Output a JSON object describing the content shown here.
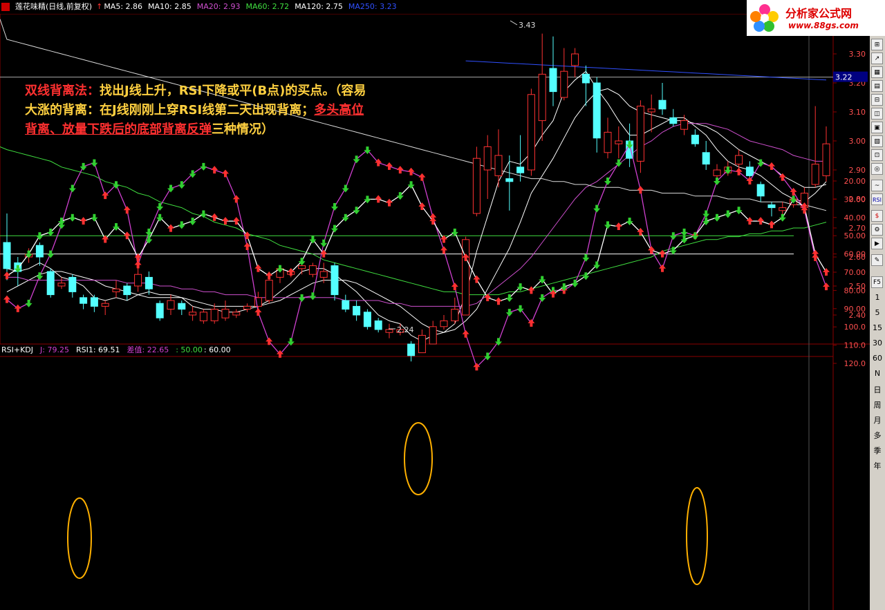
{
  "header": {
    "title": "莲花味精(日线,前复权)",
    "ma": [
      {
        "label": "MA5: 2.86",
        "color": "#ffffff"
      },
      {
        "label": "MA10: 2.85",
        "color": "#ffffff"
      },
      {
        "label": "MA20: 2.93",
        "color": "#d050d0"
      },
      {
        "label": "MA60: 2.72",
        "color": "#40e040"
      },
      {
        "label": "MA120: 2.75",
        "color": "#ffffff"
      },
      {
        "label": "MA250: 3.23",
        "color": "#3050ff"
      }
    ]
  },
  "logo": {
    "title": "分析家公式网",
    "url": "www.88gs.com"
  },
  "annotation": {
    "part1": "双线背离法：",
    "part2": "找出J线上升，RSI下降或平(B点)的买点。（容易大涨的背离：在J线刚刚上穿RSI线第二天出现背离；",
    "part3": "多头高位背离、放量下跌后的底部背离反弹",
    "part4": "三种情况）"
  },
  "subheader": {
    "name": "RSI+KDJ",
    "j": "J: 79.25",
    "rsi": "RSI1: 69.51",
    "diff": "差值: 22.65",
    "l50": ": 50.00",
    "l60": ": 60.00"
  },
  "toolbar": {
    "items": [
      "1",
      "5",
      "15",
      "30",
      "60",
      "N",
      "日",
      "周",
      "月",
      "多",
      "季",
      "年"
    ],
    "rsi_label": "RSI"
  },
  "colors": {
    "up": "#ff3232",
    "down": "#54ffff",
    "grid": "#8b0000",
    "rsi": "#ffffff",
    "j": "#d040d0",
    "line60": "#ffffff",
    "line50": "#40e040",
    "circle": "#ffb000"
  },
  "chart_data": [
    {
      "type": "candlestick",
      "title": "",
      "ylim": [
        2.32,
        3.38
      ],
      "yticks": [
        "3.30",
        "3.20",
        "3.10",
        "3.00",
        "2.90",
        "2.80",
        "2.70",
        "2.60",
        "2.50",
        "2.40"
      ],
      "current_price": "3.22",
      "high_label": "3.43",
      "low_label": "2.24",
      "candles": [
        [
          2.65,
          2.56,
          2.75,
          2.52
        ],
        [
          2.58,
          2.55,
          2.6,
          2.5
        ],
        [
          2.6,
          2.61,
          2.63,
          2.58
        ],
        [
          2.64,
          2.6,
          2.65,
          2.57
        ],
        [
          2.55,
          2.47,
          2.56,
          2.46
        ],
        [
          2.5,
          2.51,
          2.53,
          2.49
        ],
        [
          2.53,
          2.48,
          2.54,
          2.46
        ],
        [
          2.46,
          2.44,
          2.47,
          2.42
        ],
        [
          2.46,
          2.43,
          2.47,
          2.41
        ],
        [
          2.43,
          2.44,
          2.45,
          2.4
        ],
        [
          2.48,
          2.49,
          2.52,
          2.46
        ],
        [
          2.5,
          2.47,
          2.51,
          2.45
        ],
        [
          2.5,
          2.54,
          2.57,
          2.48
        ],
        [
          2.53,
          2.49,
          2.55,
          2.47
        ],
        [
          2.44,
          2.39,
          2.45,
          2.38
        ],
        [
          2.42,
          2.45,
          2.47,
          2.4
        ],
        [
          2.44,
          2.42,
          2.45,
          2.4
        ],
        [
          2.4,
          2.41,
          2.43,
          2.38
        ],
        [
          2.38,
          2.41,
          2.42,
          2.37
        ],
        [
          2.38,
          2.42,
          2.44,
          2.37
        ],
        [
          2.39,
          2.42,
          2.45,
          2.38
        ],
        [
          2.4,
          2.41,
          2.42,
          2.39
        ],
        [
          2.42,
          2.43,
          2.44,
          2.41
        ],
        [
          2.43,
          2.46,
          2.48,
          2.42
        ],
        [
          2.45,
          2.52,
          2.55,
          2.44
        ],
        [
          2.53,
          2.56,
          2.57,
          2.51
        ],
        [
          2.54,
          2.55,
          2.56,
          2.53
        ],
        [
          2.56,
          2.57,
          2.58,
          2.54
        ],
        [
          2.54,
          2.57,
          2.58,
          2.53
        ],
        [
          2.53,
          2.55,
          2.58,
          2.51
        ],
        [
          2.57,
          2.47,
          2.58,
          2.45
        ],
        [
          2.45,
          2.42,
          2.47,
          2.41
        ],
        [
          2.43,
          2.4,
          2.45,
          2.38
        ],
        [
          2.41,
          2.36,
          2.42,
          2.35
        ],
        [
          2.38,
          2.35,
          2.39,
          2.34
        ],
        [
          2.34,
          2.35,
          2.37,
          2.32
        ],
        [
          2.34,
          2.35,
          2.37,
          2.33
        ],
        [
          2.3,
          2.26,
          2.31,
          2.24
        ],
        [
          2.27,
          2.33,
          2.35,
          2.27
        ],
        [
          2.3,
          2.36,
          2.38,
          2.3
        ],
        [
          2.36,
          2.38,
          2.4,
          2.35
        ],
        [
          2.38,
          2.42,
          2.46,
          2.37
        ],
        [
          2.4,
          2.66,
          2.67,
          2.4
        ],
        [
          2.75,
          2.94,
          2.98,
          2.74
        ],
        [
          2.9,
          2.98,
          3.02,
          2.8
        ],
        [
          2.88,
          2.95,
          3.04,
          2.84
        ],
        [
          2.87,
          2.86,
          2.95,
          2.76
        ],
        [
          2.91,
          2.89,
          3.02,
          2.86
        ],
        [
          2.9,
          3.16,
          3.18,
          2.88
        ],
        [
          3.07,
          3.23,
          3.37,
          3.0
        ],
        [
          3.25,
          3.17,
          3.36,
          3.12
        ],
        [
          3.15,
          3.24,
          3.32,
          3.14
        ],
        [
          3.26,
          3.3,
          3.32,
          3.22
        ],
        [
          3.23,
          3.2,
          3.26,
          3.12
        ],
        [
          3.2,
          3.01,
          3.22,
          2.96
        ],
        [
          2.96,
          3.03,
          3.08,
          2.94
        ],
        [
          2.99,
          3.0,
          3.05,
          2.94
        ],
        [
          3.0,
          2.94,
          3.06,
          2.91
        ],
        [
          2.93,
          3.12,
          3.14,
          2.89
        ],
        [
          3.1,
          3.11,
          3.16,
          3.03
        ],
        [
          3.14,
          3.11,
          3.2,
          3.09
        ],
        [
          3.08,
          3.06,
          3.11,
          3.05
        ],
        [
          3.04,
          3.07,
          3.09,
          3.02
        ],
        [
          3.02,
          2.99,
          3.04,
          2.98
        ],
        [
          2.96,
          2.92,
          3.0,
          2.9
        ],
        [
          2.88,
          2.9,
          2.92,
          2.86
        ],
        [
          2.89,
          2.91,
          2.93,
          2.88
        ],
        [
          2.92,
          2.95,
          2.97,
          2.89
        ],
        [
          2.91,
          2.88,
          2.93,
          2.86
        ],
        [
          2.85,
          2.81,
          2.86,
          2.79
        ],
        [
          2.78,
          2.77,
          2.79,
          2.74
        ],
        [
          2.76,
          2.77,
          2.79,
          2.74
        ],
        [
          2.78,
          2.8,
          2.82,
          2.77
        ],
        [
          2.77,
          2.82,
          2.84,
          2.75
        ],
        [
          2.85,
          2.92,
          3.12,
          2.84
        ],
        [
          2.88,
          2.99,
          3.05,
          2.86
        ]
      ],
      "series": [
        {
          "name": "MA5",
          "values": [
            2.56,
            2.55,
            2.56,
            2.58,
            2.56,
            2.53,
            2.52,
            2.5,
            2.46,
            2.45,
            2.46,
            2.45,
            2.47,
            2.48,
            2.47,
            2.47,
            2.46,
            2.43,
            2.42,
            2.42,
            2.41,
            2.41,
            2.42,
            2.43,
            2.45,
            2.48,
            2.51,
            2.55,
            2.56,
            2.56,
            2.54,
            2.51,
            2.48,
            2.44,
            2.4,
            2.38,
            2.37,
            2.33,
            2.31,
            2.33,
            2.34,
            2.37,
            2.47,
            2.62,
            2.74,
            2.86,
            2.93,
            2.92,
            2.96,
            3.02,
            3.07,
            3.17,
            3.21,
            3.24,
            3.18,
            3.13,
            3.07,
            3.02,
            3.02,
            3.04,
            3.06,
            3.08,
            3.08,
            3.05,
            3.02,
            2.97,
            2.93,
            2.91,
            2.9,
            2.88,
            2.85,
            2.82,
            2.8,
            2.79,
            2.82,
            2.86
          ]
        },
        {
          "name": "MA10",
          "values": [
            2.48,
            2.5,
            2.52,
            2.54,
            2.55,
            2.55,
            2.54,
            2.53,
            2.52,
            2.5,
            2.49,
            2.48,
            2.47,
            2.46,
            2.46,
            2.46,
            2.46,
            2.45,
            2.44,
            2.43,
            2.43,
            2.43,
            2.43,
            2.43,
            2.44,
            2.45,
            2.47,
            2.49,
            2.51,
            2.52,
            2.52,
            2.52,
            2.51,
            2.49,
            2.47,
            2.45,
            2.43,
            2.4,
            2.37,
            2.35,
            2.34,
            2.35,
            2.38,
            2.42,
            2.49,
            2.56,
            2.63,
            2.72,
            2.82,
            2.88,
            2.94,
            3.01,
            3.08,
            3.13,
            3.17,
            3.18,
            3.16,
            3.12,
            3.1,
            3.09,
            3.08,
            3.07,
            3.07,
            3.06,
            3.05,
            3.03,
            3.0,
            2.97,
            2.95,
            2.93,
            2.91,
            2.88,
            2.86,
            2.84,
            2.84,
            2.85
          ]
        },
        {
          "name": "MA20",
          "values": [
            2.53,
            2.53,
            2.52,
            2.52,
            2.52,
            2.52,
            2.52,
            2.52,
            2.52,
            2.52,
            2.52,
            2.51,
            2.51,
            2.51,
            2.5,
            2.5,
            2.49,
            2.49,
            2.48,
            2.48,
            2.47,
            2.47,
            2.47,
            2.46,
            2.46,
            2.46,
            2.46,
            2.46,
            2.46,
            2.46,
            2.46,
            2.45,
            2.45,
            2.45,
            2.45,
            2.44,
            2.44,
            2.43,
            2.43,
            2.43,
            2.43,
            2.43,
            2.43,
            2.44,
            2.47,
            2.5,
            2.53,
            2.56,
            2.6,
            2.65,
            2.7,
            2.75,
            2.8,
            2.84,
            2.86,
            2.89,
            2.92,
            2.95,
            2.98,
            3.0,
            3.03,
            3.05,
            3.06,
            3.06,
            3.06,
            3.05,
            3.04,
            3.02,
            3.0,
            2.99,
            2.98,
            2.97,
            2.95,
            2.94,
            2.93,
            2.93
          ]
        },
        {
          "name": "MA60",
          "values": [
            2.97,
            2.96,
            2.95,
            2.94,
            2.93,
            2.91,
            2.9,
            2.89,
            2.88,
            2.86,
            2.85,
            2.84,
            2.82,
            2.81,
            2.79,
            2.78,
            2.77,
            2.75,
            2.74,
            2.72,
            2.71,
            2.7,
            2.68,
            2.67,
            2.66,
            2.64,
            2.63,
            2.62,
            2.61,
            2.59,
            2.58,
            2.57,
            2.56,
            2.55,
            2.54,
            2.53,
            2.52,
            2.51,
            2.5,
            2.49,
            2.48,
            2.48,
            2.47,
            2.47,
            2.47,
            2.47,
            2.48,
            2.48,
            2.49,
            2.5,
            2.51,
            2.52,
            2.53,
            2.54,
            2.55,
            2.56,
            2.57,
            2.58,
            2.59,
            2.6,
            2.62,
            2.63,
            2.64,
            2.65,
            2.66,
            2.66,
            2.67,
            2.67,
            2.68,
            2.68,
            2.69,
            2.69,
            2.7,
            2.7,
            2.71,
            2.72
          ]
        },
        {
          "name": "MA120",
          "values": [
            3.35,
            3.34,
            3.33,
            3.32,
            3.31,
            3.3,
            3.29,
            3.28,
            3.27,
            3.26,
            3.25,
            3.24,
            3.23,
            3.22,
            3.21,
            3.2,
            3.19,
            3.18,
            3.17,
            3.16,
            3.15,
            3.14,
            3.13,
            3.12,
            3.11,
            3.1,
            3.09,
            3.08,
            3.07,
            3.06,
            3.05,
            3.04,
            3.03,
            3.02,
            3.01,
            3.0,
            2.99,
            2.98,
            2.97,
            2.96,
            2.95,
            2.94,
            2.93,
            2.92,
            2.91,
            2.9,
            2.89,
            2.88,
            2.87,
            2.87,
            2.86,
            2.86,
            2.85,
            2.85,
            2.84,
            2.84,
            2.84,
            2.83,
            2.83,
            2.83,
            2.82,
            2.82,
            2.82,
            2.81,
            2.81,
            2.81,
            2.8,
            2.8,
            2.8,
            2.79,
            2.79,
            2.79,
            2.78,
            2.78,
            2.77,
            2.76
          ]
        },
        {
          "name": "MA250",
          "values": [
            3.36,
            3.358,
            3.356,
            3.354,
            3.352,
            3.35,
            3.348,
            3.346,
            3.344,
            3.342,
            3.34,
            3.338,
            3.336,
            3.334,
            3.332,
            3.33,
            3.328,
            3.326,
            3.324,
            3.322,
            3.32,
            3.318,
            3.316,
            3.314,
            3.312,
            3.31,
            3.308,
            3.306,
            3.304,
            3.302,
            3.3,
            3.298,
            3.296,
            3.294,
            3.292,
            3.29,
            3.288,
            3.286,
            3.284,
            3.282,
            3.28,
            3.278,
            3.276,
            3.274,
            3.272,
            3.27,
            3.268,
            3.266,
            3.264,
            3.262,
            3.26,
            3.258,
            3.256,
            3.254,
            3.252,
            3.25,
            3.248,
            3.246,
            3.244,
            3.242,
            3.24,
            3.238,
            3.236,
            3.234,
            3.232,
            3.23,
            3.228,
            3.226,
            3.224,
            3.222,
            3.22,
            3.218,
            3.216,
            3.214,
            3.212,
            3.21
          ]
        }
      ]
    },
    {
      "type": "line",
      "title": "RSI+KDJ",
      "ylim": [
        0,
        125
      ],
      "yticks": [
        "120.0",
        "110.0",
        "100.0",
        "90.00",
        "80.00",
        "70.00",
        "60.00",
        "50.00",
        "40.00",
        "30.00",
        "20.00"
      ],
      "series": [
        {
          "name": "J",
          "values": [
            85,
            90,
            87,
            72,
            60,
            44,
            24,
            12,
            10,
            28,
            22,
            36,
            66,
            48,
            34,
            24,
            22,
            16,
            12,
            14,
            16,
            30,
            56,
            92,
            108,
            115,
            108,
            84,
            83,
            54,
            34,
            24,
            8,
            3,
            10,
            12,
            14,
            15,
            18,
            40,
            58,
            78,
            104,
            122,
            116,
            108,
            92,
            90,
            98,
            84,
            80,
            80,
            76,
            62,
            35,
            20,
            10,
            0,
            25,
            58,
            68,
            50,
            48,
            50,
            38,
            20,
            14,
            15,
            20,
            10,
            12,
            18,
            26,
            36,
            62,
            78
          ]
        },
        {
          "name": "RSI1",
          "values": [
            72,
            68,
            60,
            50,
            48,
            42,
            40,
            42,
            40,
            52,
            45,
            50,
            62,
            52,
            40,
            46,
            44,
            42,
            38,
            40,
            42,
            42,
            50,
            68,
            72,
            68,
            70,
            64,
            52,
            60,
            46,
            40,
            36,
            30,
            30,
            32,
            28,
            22,
            34,
            42,
            52,
            48,
            62,
            74,
            84,
            86,
            84,
            78,
            80,
            74,
            82,
            78,
            76,
            72,
            66,
            44,
            45,
            42,
            48,
            58,
            60,
            58,
            52,
            50,
            42,
            40,
            38,
            36,
            42,
            42,
            44,
            40,
            30,
            34,
            60,
            70
          ]
        }
      ]
    }
  ]
}
